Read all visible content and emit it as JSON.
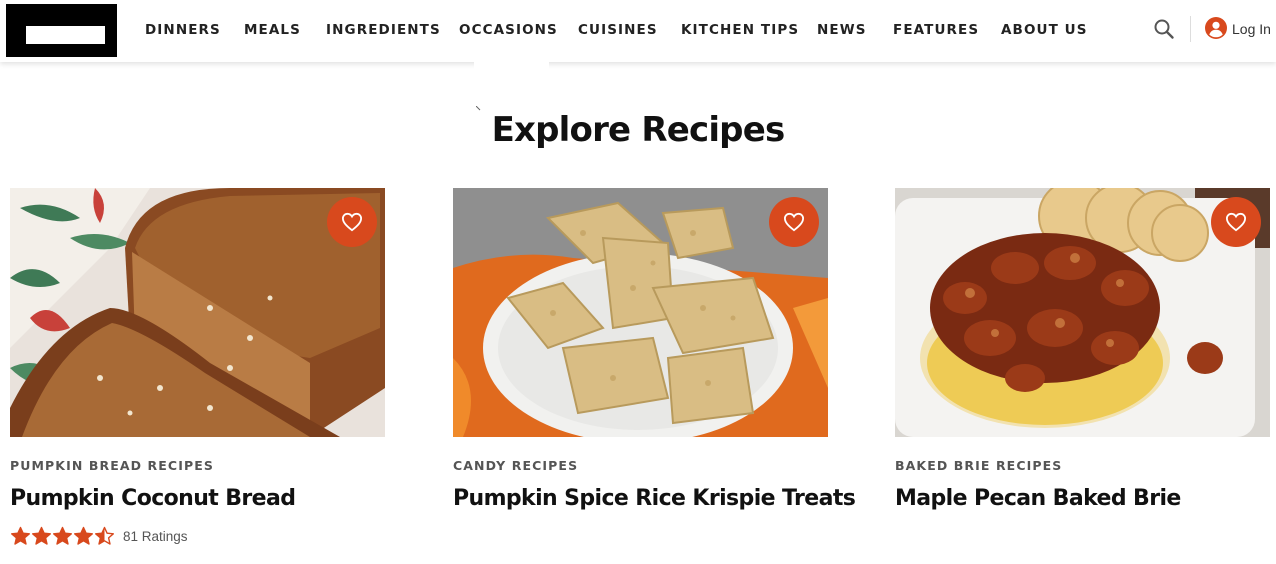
{
  "header": {
    "nav": [
      {
        "label": "DINNERS"
      },
      {
        "label": "MEALS"
      },
      {
        "label": "INGREDIENTS"
      },
      {
        "label": "OCCASIONS"
      },
      {
        "label": "CUISINES"
      },
      {
        "label": "KITCHEN TIPS"
      },
      {
        "label": "NEWS"
      },
      {
        "label": "FEATURES"
      },
      {
        "label": "ABOUT US"
      }
    ],
    "login_label": "Log In",
    "icons": {
      "search": "search-icon",
      "account": "account-icon"
    }
  },
  "main": {
    "title": "Explore Recipes",
    "cards": [
      {
        "tag": "PUMPKIN BREAD RECIPES",
        "title": "Pumpkin Coconut Bread",
        "rating": 4.5,
        "ratings_text": "81 Ratings"
      },
      {
        "tag": "CANDY RECIPES",
        "title": "Pumpkin Spice Rice Krispie Treats"
      },
      {
        "tag": "BAKED BRIE RECIPES",
        "title": "Maple Pecan Baked Brie"
      }
    ]
  },
  "colors": {
    "accent": "#d8491d",
    "text": "#111111",
    "muted": "#555555"
  }
}
